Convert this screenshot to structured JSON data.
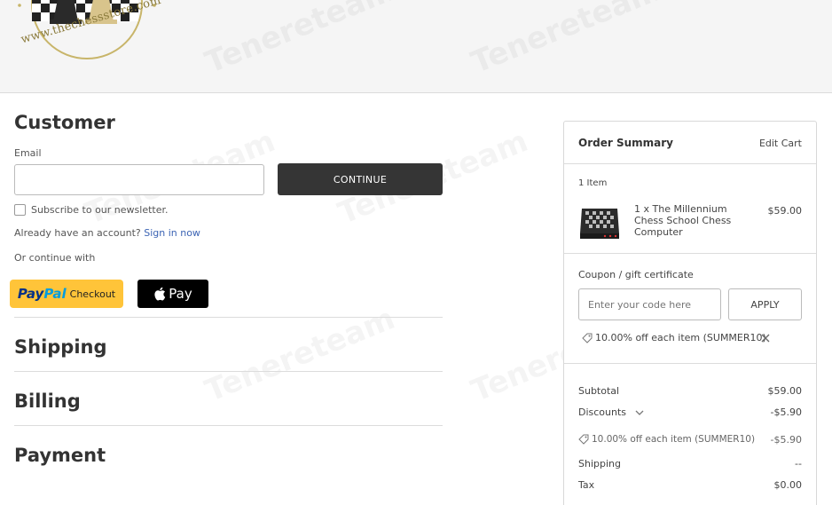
{
  "header": {
    "logo_text": "www.thechessstore.com"
  },
  "watermark": "Tenereteam",
  "customer": {
    "title": "Customer",
    "email_label": "Email",
    "email_value": "",
    "continue_label": "CONTINUE",
    "newsletter_label": "Subscribe to our newsletter.",
    "account_prompt": "Already have an account?",
    "sign_in_label": "Sign in now",
    "continue_with": "Or continue with",
    "paypal_pay": "Pay",
    "paypal_pal": "Pal",
    "paypal_checkout": "Checkout",
    "apple_pay_label": "Pay"
  },
  "sections": {
    "shipping": "Shipping",
    "billing": "Billing",
    "payment": "Payment"
  },
  "summary": {
    "title": "Order Summary",
    "edit_cart": "Edit Cart",
    "item_count": "1 Item",
    "item_line1": "1 x The Millennium",
    "item_line2": "Chess School Chess",
    "item_line3": "Computer",
    "item_price": "$59.00",
    "coupon_link": "Coupon / gift certificate",
    "coupon_placeholder": "Enter your code here",
    "apply_label": "APPLY",
    "applied_coupon": "10.00% off each item (SUMMER10)",
    "subtotal_label": "Subtotal",
    "subtotal_value": "$59.00",
    "discounts_label": "Discounts",
    "discounts_value": "-$5.90",
    "discount_detail": "10.00% off each item (SUMMER10)",
    "discount_detail_value": "-$5.90",
    "shipping_label": "Shipping",
    "shipping_value": "--",
    "tax_label": "Tax",
    "tax_value": "$0.00"
  },
  "colors": {
    "link": "#3c64b4",
    "continue_bg": "#353535",
    "paypal_bg": "#ffc439"
  }
}
